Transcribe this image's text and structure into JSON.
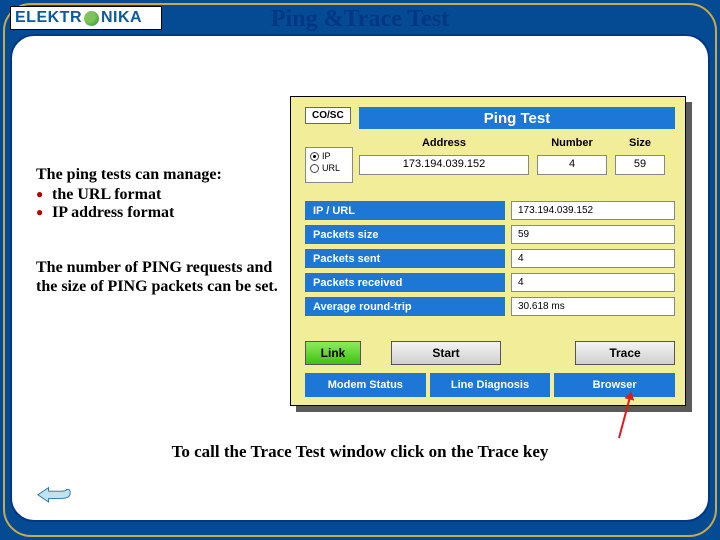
{
  "logo": {
    "left": "ELEKTR",
    "right": "NIKA"
  },
  "title": "Ping &Trace Test",
  "left_text": {
    "heading": "The ping tests can manage:",
    "items": [
      "the URL format",
      "IP address format"
    ],
    "paragraph": "The number of PING requests and the size of PING packets can be set."
  },
  "bottom_line": "To call the Trace Test window click on the Trace key",
  "device": {
    "co_sc": "CO/SC",
    "title": "Ping Test",
    "col_headers": [
      "Address",
      "Number",
      "Size"
    ],
    "radio": {
      "ip_label": "IP",
      "url_label": "URL",
      "selected": "ip"
    },
    "inputs": {
      "address": "173.194.039.152",
      "number": "4",
      "size": "59"
    },
    "results": [
      {
        "label": "IP / URL",
        "value": "173.194.039.152"
      },
      {
        "label": "Packets size",
        "value": "59"
      },
      {
        "label": "Packets sent",
        "value": "4"
      },
      {
        "label": "Packets received",
        "value": "4"
      },
      {
        "label": "Average round-trip",
        "value": "30.618 ms"
      }
    ],
    "buttons": {
      "link": "Link",
      "start": "Start",
      "trace": "Trace"
    },
    "bottom_bar": [
      "Modem Status",
      "Line Diagnosis",
      "Browser"
    ]
  }
}
